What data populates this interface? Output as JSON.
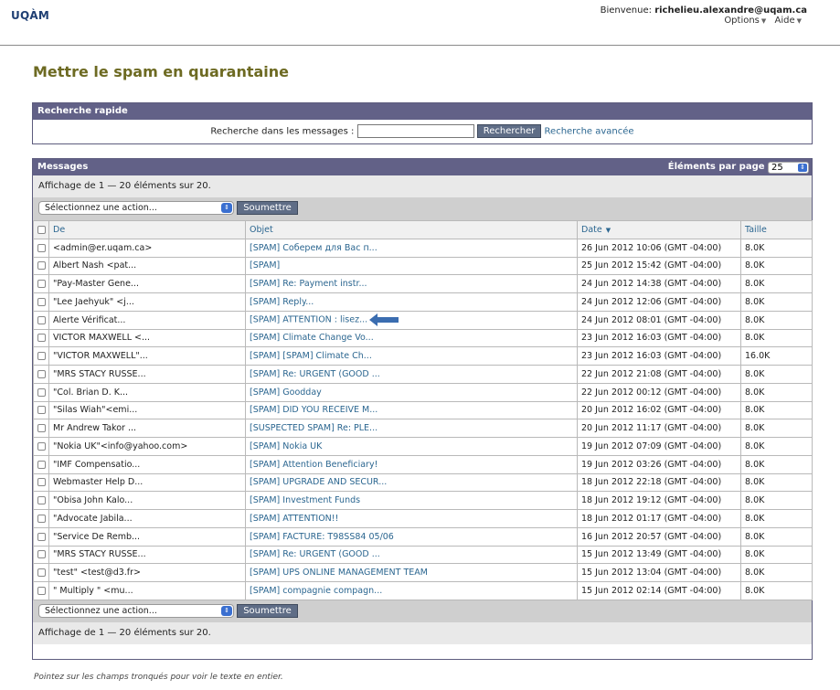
{
  "brand": {
    "logo": "UQÀM"
  },
  "user": {
    "welcome": "Bienvenue:",
    "email": "richelieu.alexandre@uqam.ca",
    "menu": [
      "Options",
      "Aide"
    ]
  },
  "page_title": "Mettre le spam en quarantaine",
  "quick_search": {
    "title": "Recherche rapide",
    "label": "Recherche dans les messages :",
    "input_value": "",
    "button": "Rechercher",
    "advanced_link": "Recherche avancée"
  },
  "messages": {
    "title": "Messages",
    "per_page_label": "Éléments par page",
    "per_page_value": "25",
    "info_top": "Affichage de 1 — 20 éléments sur 20.",
    "info_bottom": "Affichage de 1 — 20 éléments sur 20.",
    "action_select": "Sélectionnez une action...",
    "submit": "Soumettre",
    "columns": {
      "from": "De",
      "subject": "Objet",
      "date": "Date",
      "size": "Taille"
    },
    "rows": [
      {
        "from": "<admin@er.uqam.ca>",
        "subject": "[SPAM] Соберем для Вас п...",
        "date": "26 Jun 2012 10:06 (GMT -04:00)",
        "size": "8.0K"
      },
      {
        "from": "Albert Nash <pat...",
        "subject": "[SPAM]",
        "date": "25 Jun 2012 15:42 (GMT -04:00)",
        "size": "8.0K"
      },
      {
        "from": "\"Pay-Master Gene...",
        "subject": "[SPAM] Re: Payment instr...",
        "date": "24 Jun 2012 14:38 (GMT -04:00)",
        "size": "8.0K"
      },
      {
        "from": "\"Lee Jaehyuk\" <j...",
        "subject": "[SPAM] Reply...",
        "date": "24 Jun 2012 12:06 (GMT -04:00)",
        "size": "8.0K"
      },
      {
        "from": "Alerte Vérificat...",
        "subject": "[SPAM] ATTENTION : lisez...",
        "date": "24 Jun 2012 08:01 (GMT -04:00)",
        "size": "8.0K"
      },
      {
        "from": "VICTOR MAXWELL <...",
        "subject": "[SPAM] Climate Change Vo...",
        "date": "23 Jun 2012 16:03 (GMT -04:00)",
        "size": "8.0K"
      },
      {
        "from": "\"VICTOR MAXWELL\"...",
        "subject": "[SPAM] [SPAM] Climate Ch...",
        "date": "23 Jun 2012 16:03 (GMT -04:00)",
        "size": "16.0K"
      },
      {
        "from": "\"MRS STACY RUSSE...",
        "subject": "[SPAM] Re: URGENT (GOOD ...",
        "date": "22 Jun 2012 21:08 (GMT -04:00)",
        "size": "8.0K"
      },
      {
        "from": "\"Col. Brian D. K...",
        "subject": "[SPAM] Goodday",
        "date": "22 Jun 2012 00:12 (GMT -04:00)",
        "size": "8.0K"
      },
      {
        "from": "\"Silas Wiah\"<emi...",
        "subject": "[SPAM] DID YOU RECEIVE M...",
        "date": "20 Jun 2012 16:02 (GMT -04:00)",
        "size": "8.0K"
      },
      {
        "from": "Mr Andrew Takor ...",
        "subject": "[SUSPECTED SPAM] Re: PLE...",
        "date": "20 Jun 2012 11:17 (GMT -04:00)",
        "size": "8.0K"
      },
      {
        "from": "\"Nokia UK\"<info@yahoo.com>",
        "subject": "[SPAM] Nokia UK",
        "date": "19 Jun 2012 07:09 (GMT -04:00)",
        "size": "8.0K"
      },
      {
        "from": "\"IMF Compensatio...",
        "subject": "[SPAM] Attention Beneficiary!",
        "date": "19 Jun 2012 03:26 (GMT -04:00)",
        "size": "8.0K"
      },
      {
        "from": "Webmaster Help D...",
        "subject": "[SPAM] UPGRADE AND SECUR...",
        "date": "18 Jun 2012 22:18 (GMT -04:00)",
        "size": "8.0K"
      },
      {
        "from": "\"Obisa John Kalo...",
        "subject": "[SPAM] Investment Funds",
        "date": "18 Jun 2012 19:12 (GMT -04:00)",
        "size": "8.0K"
      },
      {
        "from": "\"Advocate Jabila...",
        "subject": "[SPAM] ATTENTION!!",
        "date": "18 Jun 2012 01:17 (GMT -04:00)",
        "size": "8.0K"
      },
      {
        "from": "\"Service De Remb...",
        "subject": "[SPAM] FACTURE: T98SS84 05/06",
        "date": "16 Jun 2012 20:57 (GMT -04:00)",
        "size": "8.0K"
      },
      {
        "from": "\"MRS STACY RUSSE...",
        "subject": "[SPAM] Re: URGENT (GOOD ...",
        "date": "15 Jun 2012 13:49 (GMT -04:00)",
        "size": "8.0K"
      },
      {
        "from": "\"test\" <test@d3.fr>",
        "subject": "[SPAM] UPS ONLINE MANAGEMENT TEAM",
        "date": "15 Jun 2012 13:04 (GMT -04:00)",
        "size": "8.0K"
      },
      {
        "from": "\" Multiply \" <mu...",
        "subject": "[SPAM] compagnie compagn...",
        "date": "15 Jun 2012 02:14 (GMT -04:00)",
        "size": "8.0K"
      }
    ]
  },
  "footer_note": "Pointez sur les champs tronqués pour voir le texte en entier.",
  "colors": {
    "header_bar": "#626187",
    "title": "#6d6a22",
    "link": "#2b6690",
    "annotation_arrow": "#3b6db0"
  }
}
